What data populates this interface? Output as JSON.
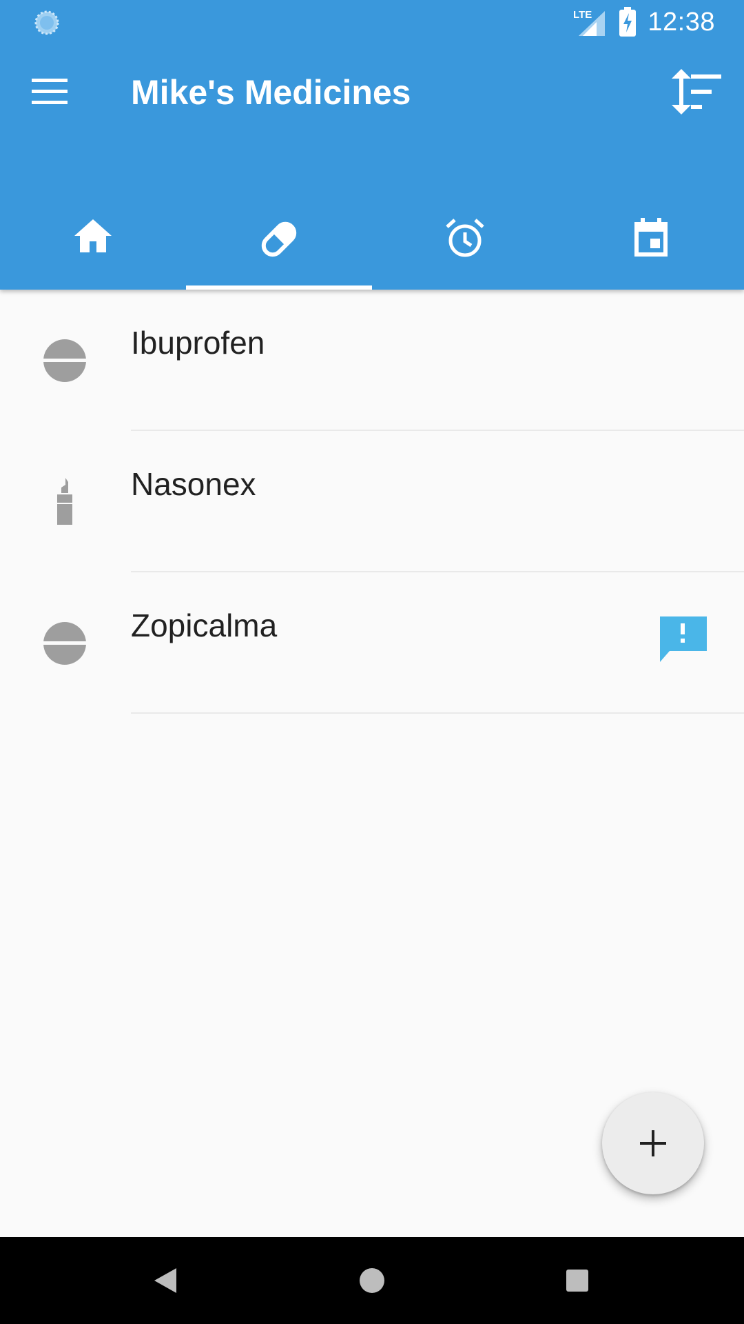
{
  "status_bar": {
    "time": "12:38",
    "network_label": "LTE",
    "icons": [
      "loading-icon",
      "lte-signal-icon",
      "battery-charging-icon"
    ]
  },
  "toolbar": {
    "title": "Mike's Medicines",
    "menu_icon": "menu-icon",
    "sort_icon": "sort-icon"
  },
  "tabs": [
    {
      "icon": "home-icon",
      "selected": false
    },
    {
      "icon": "pill-icon",
      "selected": true
    },
    {
      "icon": "alarm-icon",
      "selected": false
    },
    {
      "icon": "calendar-icon",
      "selected": false
    }
  ],
  "medicines": [
    {
      "name": "Ibuprofen",
      "icon": "tablet-icon",
      "has_note": false
    },
    {
      "name": "Nasonex",
      "icon": "nasal-spray-icon",
      "has_note": false
    },
    {
      "name": "Zopicalma",
      "icon": "tablet-icon",
      "has_note": true
    }
  ],
  "fab": {
    "icon": "plus-icon"
  },
  "nav": {
    "icons": [
      "back-icon",
      "home-nav-icon",
      "recents-icon"
    ]
  },
  "colors": {
    "primary": "#3a98dc",
    "note_accent": "#4ab6e8",
    "icon_grey": "#9e9e9e",
    "text": "#212121"
  }
}
